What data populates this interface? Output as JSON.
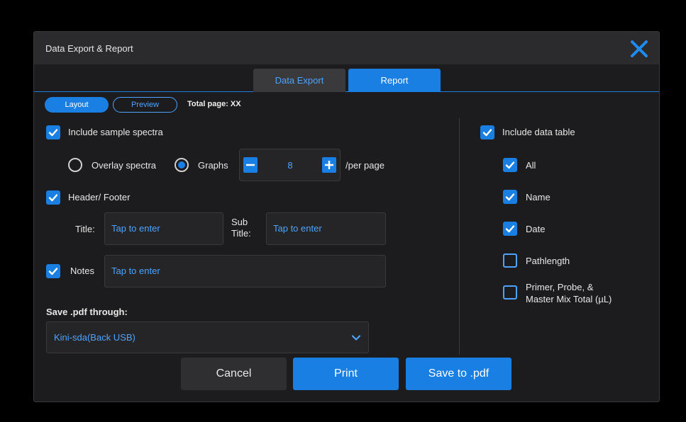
{
  "dialog": {
    "title": "Data Export & Report"
  },
  "tabs": [
    {
      "label": "Data Export"
    },
    {
      "label": "Report"
    }
  ],
  "view": {
    "layout_label": "Layout",
    "preview_label": "Preview",
    "total_page": "Total page: XX"
  },
  "spectra": {
    "include_label": "Include sample spectra",
    "include_checked": true,
    "overlay_label": "Overlay spectra",
    "graphs_label": "Graphs",
    "selected_mode": "Graphs",
    "per_page_value": "8",
    "per_page_suffix": "/per page"
  },
  "header_footer": {
    "label": "Header/ Footer",
    "checked": true,
    "title_label": "Title:",
    "title_placeholder": "Tap to enter",
    "subtitle_label_line1": "Sub",
    "subtitle_label_line2": "Title:",
    "subtitle_placeholder": "Tap to enter"
  },
  "notes": {
    "label": "Notes",
    "checked": true,
    "placeholder": "Tap to enter"
  },
  "save_through": {
    "label": "Save .pdf through:",
    "selected": "Kini-sda(Back USB)"
  },
  "data_table": {
    "include_label": "Include data table",
    "include_checked": true,
    "options": [
      {
        "label": "All",
        "checked": true
      },
      {
        "label": "Name",
        "checked": true
      },
      {
        "label": "Date",
        "checked": true
      },
      {
        "label": "Pathlength",
        "checked": false
      },
      {
        "label_line1": "Primer, Probe, &",
        "label_line2": "Master Mix Total (µL)",
        "checked": false
      }
    ]
  },
  "actions": {
    "cancel": "Cancel",
    "print": "Print",
    "save_pdf": "Save to .pdf"
  },
  "colors": {
    "accent": "#1a7fe3",
    "accent_text": "#4da3ff",
    "dialog_bg": "#1c1c1e",
    "titlebar_bg": "#2b2b2e"
  }
}
